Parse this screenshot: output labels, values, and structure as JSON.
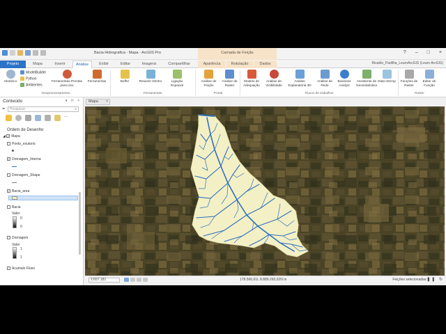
{
  "window": {
    "title": "Bacia Hidrografica - Mapa - ArcGIS Pro",
    "context_tab_header": "Camada de Feição",
    "controls": [
      "?",
      "–",
      "□",
      "×"
    ],
    "user": "Rivaldo_Padilha_LearnArcGIS (Learn ArcGIS)"
  },
  "ribbon_tabs": [
    "Projeto",
    "Mapa",
    "Inserir",
    "Análise",
    "Exibir",
    "Editar",
    "Imagens",
    "Compartilhar",
    "Aparência",
    "Rotulação",
    "Dados"
  ],
  "ribbon": {
    "historico": "Histórico",
    "modelbuilder": "ModelBuilder",
    "python": "Python",
    "ambientes": "Ambientes",
    "ferramentas_prontas": "Ferramentas Prontas para Uso",
    "ferramentas": "Ferramentas",
    "group_geoprocessamento": "Geoprocessamento",
    "buffer": "Buffer",
    "resumir_dentro": "Resumir Dentro",
    "ligacao_espacial": "Ligação Espacial",
    "group_ferramentas": "Ferramentas",
    "analise_feicao": "Análise de Feição",
    "analise_raster": "Análise de Raster",
    "group_portal": "Portal",
    "modelo_adequacao": "Modelo de Adequação",
    "analise_visibilidade": "Análise de Visibilidade",
    "analise_explanatoria": "Análise Explanatória 3D",
    "analise_rede": "Análise de Rede",
    "business_analyst": "Business Analyst",
    "assistente_geoestatistica": "Assistente de Geoestatística",
    "data_interop": "Data Interop",
    "group_fluxos": "Fluxos de trabalhos",
    "funcoes_raster": "Funções de Raster",
    "editor_funcao": "Editor de Função",
    "group_raster": "Raster"
  },
  "contents": {
    "title": "Conteúdo",
    "search_placeholder": "Pesquisar",
    "drawing_order": "Ordem de Desenho",
    "layers": [
      {
        "name": "Mapa",
        "checked": true
      },
      {
        "name": "Ponto_exutorio",
        "checked": false
      },
      {
        "name": "Drenagem_Interna",
        "checked": true
      },
      {
        "name": "Drenagem_Shape",
        "checked": false
      },
      {
        "name": "Bacia_area",
        "checked": true
      },
      {
        "name": "Bacia",
        "checked": false
      },
      {
        "name": "Drenagem",
        "checked": false
      },
      {
        "name": "Acumulo Fluxo",
        "checked": false
      }
    ],
    "bacia_legend": {
      "label": "Valor",
      "high": "0",
      "low": "0"
    },
    "drenagem_legend": {
      "label": "Valor",
      "high": "1",
      "low": "1"
    }
  },
  "map_tab": {
    "label": "Mapa"
  },
  "statusbar": {
    "scale": "1:657.181",
    "coords": "178.566,61L 8.889.260,02N m",
    "selected": "Feições selecionadas: 1"
  },
  "colors": {
    "project_tab": "#2c72c7",
    "context_tab": "#f7e3c8",
    "basin_fill": "#f3f0c6",
    "drainage": "#2f6fbb",
    "imagery_dark": "#3d3a22",
    "imagery_light": "#6e6236"
  }
}
